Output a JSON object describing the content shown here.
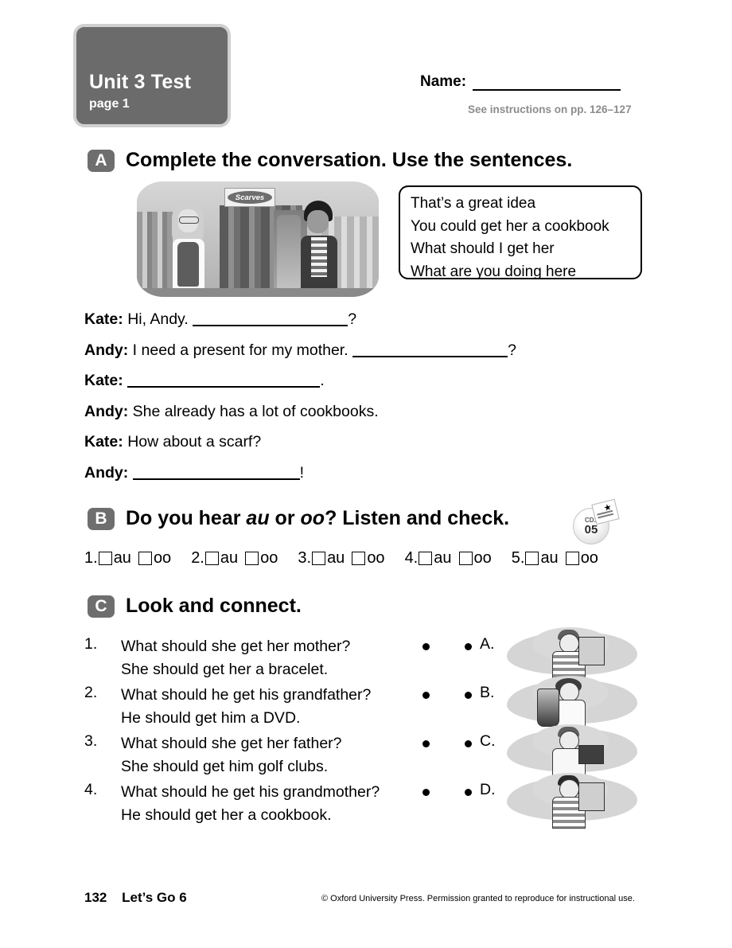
{
  "header": {
    "unit_title": "Unit 3 Test",
    "page_label": "page 1",
    "name_label": "Name:",
    "instructions": "See instructions on pp. 126–127"
  },
  "sections": {
    "a": {
      "letter": "A",
      "title": "Complete the conversation. Use the sentences.",
      "image": {
        "name": "scarves-shop-scene",
        "sign_text": "Scarves",
        "alt": "A girl and a boy talking in a scarf shop"
      },
      "sentence_bank": [
        "That’s a great idea",
        "You could get her a cookbook",
        "What should I get her",
        "What are you doing here"
      ],
      "dialogue": [
        {
          "speaker": "Kate:",
          "before": "Hi, Andy.",
          "blank": 195,
          "after": "?"
        },
        {
          "speaker": "Andy:",
          "before": "I need a present for my mother.",
          "blank": 195,
          "after": "?"
        },
        {
          "speaker": "Kate:",
          "before": "",
          "blank": 242,
          "after": "."
        },
        {
          "speaker": "Andy:",
          "before": "She already has a lot of cookbooks.",
          "blank": 0,
          "after": ""
        },
        {
          "speaker": "Kate:",
          "before": "How about a scarf?",
          "blank": 0,
          "after": ""
        },
        {
          "speaker": "Andy:",
          "before": "",
          "blank": 210,
          "after": "!"
        }
      ]
    },
    "b": {
      "letter": "B",
      "title_part1": "Do you hear ",
      "title_em1": "au",
      "title_part2": " or ",
      "title_em2": "oo",
      "title_part3": "? Listen and check.",
      "audio_icon": {
        "cd_label": "CD1",
        "track": "05"
      },
      "items": [
        {
          "num": "1.",
          "option1": "au",
          "option2": "oo"
        },
        {
          "num": "2.",
          "option1": "au",
          "option2": "oo"
        },
        {
          "num": "3.",
          "option1": "au",
          "option2": "oo"
        },
        {
          "num": "4.",
          "option1": "au",
          "option2": "oo"
        },
        {
          "num": "5.",
          "option1": "au",
          "option2": "oo"
        }
      ]
    },
    "c": {
      "letter": "C",
      "title": "Look and connect.",
      "items": [
        {
          "num": "1.",
          "line1": "What should she get her mother?",
          "line2": "She should get her a bracelet.",
          "letter": "A.",
          "image_alt": "Boy holding a DVD case"
        },
        {
          "num": "2.",
          "line1": "What should he get his grandfather?",
          "line2": "He should get him a DVD.",
          "letter": "B.",
          "image_alt": "Girl waving next to a golf bag with clubs"
        },
        {
          "num": "3.",
          "line1": "What should she get her father?",
          "line2": "She should get him golf clubs.",
          "letter": "C.",
          "image_alt": "Girl holding an open bracelet box"
        },
        {
          "num": "4.",
          "line1": "What should he get his grandmother?",
          "line2": "He should get her a cookbook.",
          "letter": "D.",
          "image_alt": "Boy holding a cookbook"
        }
      ]
    }
  },
  "footer": {
    "page_number": "132",
    "book_title": "Let’s Go 6",
    "copyright": "© Oxford University Press. Permission granted to reproduce for instructional use."
  },
  "colors": {
    "badge_gray": "#6b6b6b",
    "badge_border": "#d0d0d0",
    "section_letter_gray": "#6e6e6e",
    "muted_text": "#8c8c8c"
  }
}
